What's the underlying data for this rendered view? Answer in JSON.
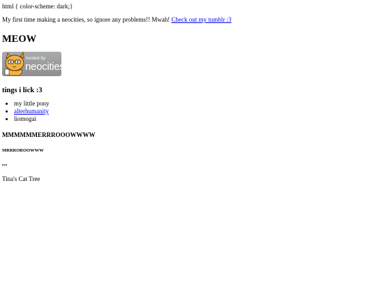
{
  "css_leak_text": "html { color-scheme: dark;}",
  "intro": {
    "text": "My first time making a neocities, so ignore any problems!! Mwah!",
    "link_text": "Check out my tumblr :3"
  },
  "title": "MEOW",
  "badge": {
    "small_text": "hosted by",
    "big_text": "neocities"
  },
  "likes": {
    "heading": "tings i lick :3",
    "items": [
      {
        "label": "my little pony",
        "link": false
      },
      {
        "label": "alterhumanity",
        "link": true
      },
      {
        "label": "liomogai",
        "link": false
      }
    ]
  },
  "headings": {
    "meow": "MMMMMMERRROOOWWWW",
    "mrr": "MRRROROOWWW",
    "nya": "nya"
  },
  "cat_tree": "Tina's Cat Tree",
  "colors": {
    "link": "#0000ee",
    "background": "#ffffff",
    "text": "#000000",
    "badge_gray": "#9a9c9e",
    "cat_orange": "#f0a030"
  },
  "icons": {
    "badge": "neocities-cat-icon"
  }
}
